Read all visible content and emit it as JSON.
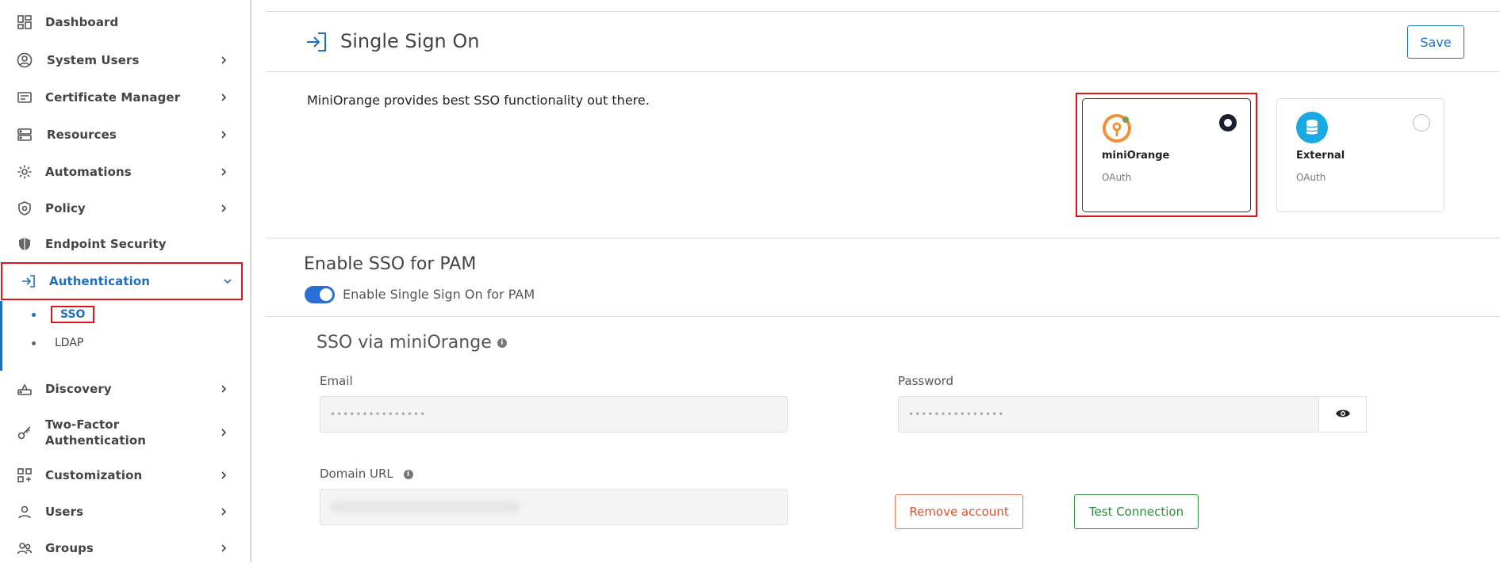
{
  "sidebar": {
    "items": [
      {
        "label": "Dashboard",
        "icon": "dashboard-icon"
      },
      {
        "label": "System Users",
        "icon": "user-circle-icon"
      },
      {
        "label": "Certificate Manager",
        "icon": "certificate-icon"
      },
      {
        "label": "Resources",
        "icon": "server-icon"
      },
      {
        "label": "Automations",
        "icon": "gear-icon"
      },
      {
        "label": "Policy",
        "icon": "shield-check-icon"
      },
      {
        "label": "Endpoint Security",
        "icon": "shield-icon"
      },
      {
        "label": "Authentication",
        "icon": "login-icon"
      },
      {
        "label": "Discovery",
        "icon": "router-icon"
      },
      {
        "label": "Two-Factor",
        "label2": "Authentication",
        "icon": "key-icon"
      },
      {
        "label": "Customization",
        "icon": "grid-plus-icon"
      },
      {
        "label": "Users",
        "icon": "user-icon"
      },
      {
        "label": "Groups",
        "icon": "users-icon"
      }
    ],
    "sub_items": [
      {
        "label": "SSO"
      },
      {
        "label": "LDAP"
      }
    ]
  },
  "header": {
    "title": "Single Sign On",
    "save_label": "Save"
  },
  "main": {
    "description": "MiniOrange provides best SSO functionality out there.",
    "cards": [
      {
        "name": "miniOrange",
        "type": "OAuth",
        "selected": true
      },
      {
        "name": "External",
        "type": "OAuth",
        "selected": false
      }
    ],
    "enable_section": {
      "title": "Enable SSO for PAM",
      "toggle_label": "Enable Single Sign On for PAM",
      "toggle_on": true
    },
    "sso_section": {
      "title": "SSO via miniOrange",
      "email_label": "Email",
      "email_value": "•••••••••••••••",
      "password_label": "Password",
      "password_value": "•••••••••••••••",
      "domain_label": "Domain URL",
      "remove_label": "Remove account",
      "test_label": "Test Connection"
    }
  },
  "colors": {
    "accent": "#1f6fbf",
    "highlight": "#e0141a",
    "remove": "#d9542e",
    "test": "#2e8b3a"
  }
}
